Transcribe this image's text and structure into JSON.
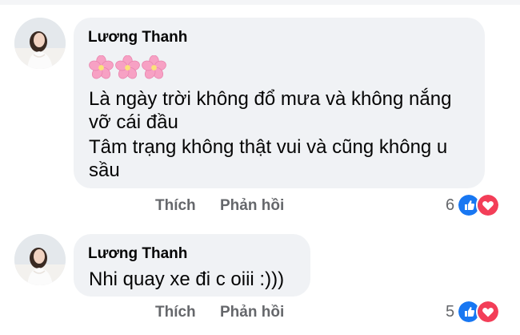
{
  "comments": [
    {
      "author": "Lương Thanh",
      "lines": [
        "Là ngày trời không đổ mưa và không nắng",
        "vỡ cái đầu",
        "Tâm trạng không thật vui và cũng không u",
        "sầu"
      ],
      "emoji": [
        "cherry-blossom-icon",
        "cherry-blossom-icon",
        "cherry-blossom-icon"
      ],
      "like_label": "Thích",
      "reply_label": "Phản hồi",
      "reaction_count": "6",
      "reactions": [
        "like-reaction-icon",
        "love-reaction-icon"
      ]
    },
    {
      "author": "Lương Thanh",
      "lines": [
        "Nhi quay xe đi c oiii :)))"
      ],
      "like_label": "Thích",
      "reply_label": "Phản hồi",
      "reaction_count": "5",
      "reactions": [
        "like-reaction-icon",
        "love-reaction-icon"
      ]
    }
  ],
  "colors": {
    "bubble": "#f0f2f5",
    "secondary_text": "#65676b",
    "like_blue": "#1877f2",
    "love_red": "#f33e58",
    "flower_pink": "#f7a1c4"
  }
}
